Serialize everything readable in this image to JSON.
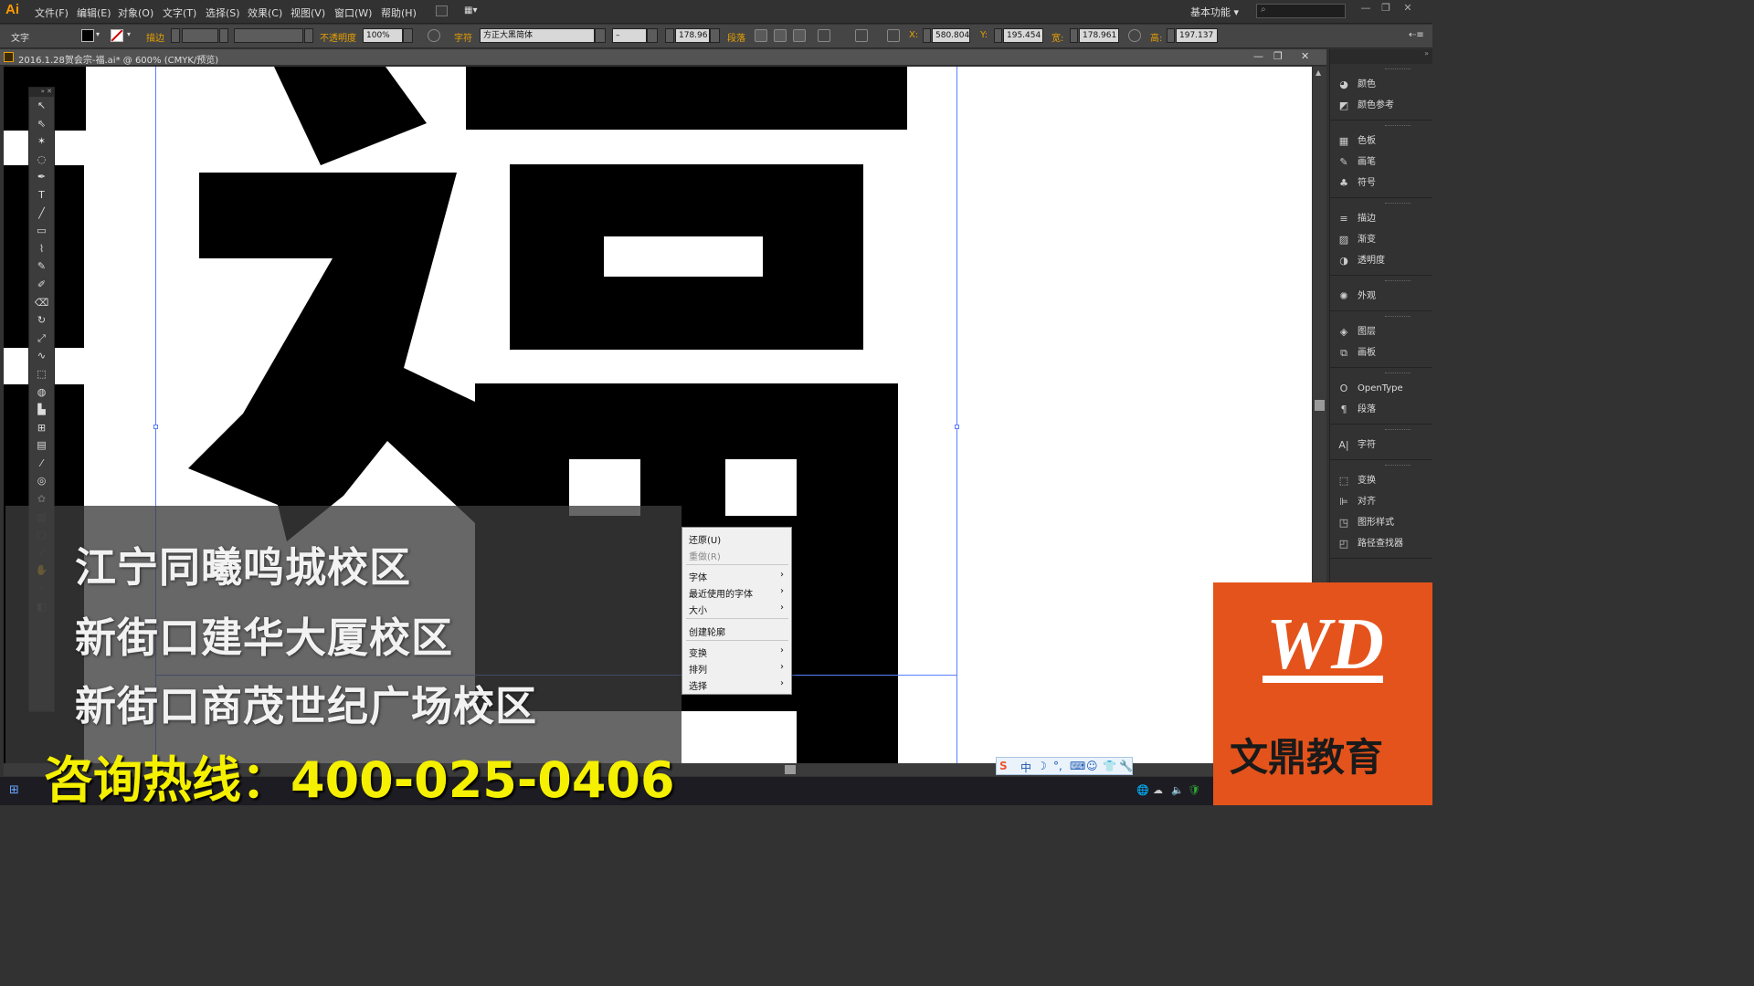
{
  "app": {
    "logo": "Ai"
  },
  "menu": [
    "文件(F)",
    "编辑(E)",
    "对象(O)",
    "文字(T)",
    "选择(S)",
    "效果(C)",
    "视图(V)",
    "窗口(W)",
    "帮助(H)"
  ],
  "workspace": "基本功能",
  "search": {
    "icon": "search-icon"
  },
  "window_buttons": [
    "—",
    "❐",
    "✕"
  ],
  "control_bar": {
    "mode_label": "文字",
    "stroke_label": "描边",
    "opacity_label": "不透明度",
    "opacity_value": "100%",
    "char_label": "字符",
    "font_name": "方正大黑简体",
    "font_style": "–",
    "font_size": "178.96",
    "para_label": "段落",
    "x_label": "X:",
    "x_value": "580.804",
    "y_label": "Y:",
    "y_value": "195.454",
    "w_label": "宽:",
    "w_value": "178.961",
    "h_label": "高:",
    "h_value": "197.137",
    "fill_color": "#000000",
    "stroke_color": "#cc0000"
  },
  "document_tab": {
    "title": "2016.1.28贺会宗-福.ai* @ 600% (CMYK/预览)"
  },
  "tools": [
    "select-tool",
    "direct-select-tool",
    "magic-wand-tool",
    "lasso-tool",
    "pen-tool",
    "type-tool",
    "line-tool",
    "rectangle-tool",
    "paintbrush-tool",
    "pencil-tool",
    "blob-brush-tool",
    "eraser-tool",
    "rotate-tool",
    "scale-tool",
    "warp-tool",
    "free-transform-tool",
    "shape-builder-tool",
    "graph-tool",
    "mesh-tool",
    "gradient-tool",
    "eyedropper-tool",
    "blend-tool",
    "symbol-sprayer-tool",
    "column-graph-tool",
    "artboard-tool",
    "slice-tool",
    "hand-tool",
    "zoom-tool"
  ],
  "panels": [
    {
      "items": [
        {
          "label": "颜色",
          "icon": "color-icon"
        },
        {
          "label": "颜色参考",
          "icon": "color-guide-icon"
        }
      ]
    },
    {
      "items": [
        {
          "label": "色板",
          "icon": "swatches-icon"
        },
        {
          "label": "画笔",
          "icon": "brushes-icon"
        },
        {
          "label": "符号",
          "icon": "symbols-icon"
        }
      ]
    },
    {
      "items": [
        {
          "label": "描边",
          "icon": "stroke-icon"
        },
        {
          "label": "渐变",
          "icon": "gradient-icon"
        },
        {
          "label": "透明度",
          "icon": "transparency-icon"
        }
      ]
    },
    {
      "items": [
        {
          "label": "外观",
          "icon": "appearance-icon"
        }
      ]
    },
    {
      "items": [
        {
          "label": "图层",
          "icon": "layers-icon"
        },
        {
          "label": "画板",
          "icon": "artboards-icon"
        }
      ]
    },
    {
      "items": [
        {
          "label": "OpenType",
          "icon": "opentype-icon"
        },
        {
          "label": "段落",
          "icon": "paragraph-icon"
        }
      ]
    },
    {
      "items": [
        {
          "label": "字符",
          "icon": "character-icon"
        }
      ]
    },
    {
      "items": [
        {
          "label": "变换",
          "icon": "transform-icon"
        },
        {
          "label": "对齐",
          "icon": "align-icon"
        },
        {
          "label": "图形样式",
          "icon": "graphic-styles-icon"
        },
        {
          "label": "路径查找器",
          "icon": "pathfinder-icon"
        }
      ]
    }
  ],
  "context_menu": {
    "undo": "还原(U)",
    "redo": "重做(R)",
    "font": "字体",
    "recent_fonts": "最近使用的字体",
    "size": "大小",
    "create_outlines": "创建轮廓",
    "transform": "变换",
    "arrange": "排列",
    "select": "选择",
    "submenu_arrow": "›"
  },
  "overlay": {
    "lines": [
      "江宁同曦鸣城校区",
      "新街口建华大厦校区",
      "新街口商茂世纪广场校区"
    ],
    "hotline": "咨询热线：400-025-0406"
  },
  "brand": {
    "logo_text": "WD",
    "name": "文鼎教育",
    "color": "#e4531b"
  },
  "ime": [
    "S",
    "中",
    "☽",
    "°,",
    "⌨",
    "☺",
    "👕",
    "🔧"
  ],
  "tray": [
    "🌐",
    "☁",
    "🔈",
    "🛡"
  ]
}
